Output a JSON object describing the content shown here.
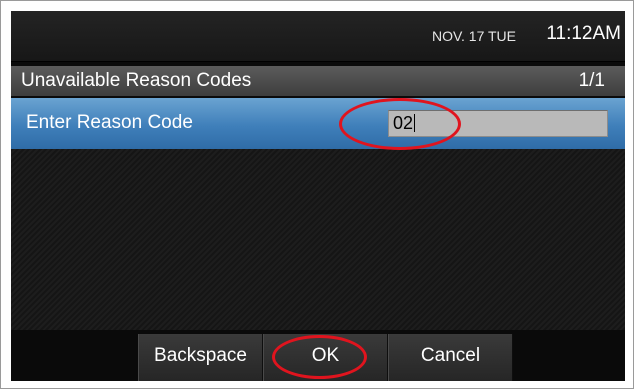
{
  "status": {
    "date": "NOV. 17 TUE",
    "time": "11:12AM"
  },
  "header": {
    "title": "Unavailable Reason Codes",
    "page": "1/1"
  },
  "entry": {
    "label": "Enter Reason Code",
    "value": "02"
  },
  "softkeys": {
    "backspace": "Backspace",
    "ok": "OK",
    "cancel": "Cancel"
  },
  "colors": {
    "highlight_row": "#3f7fba",
    "annotation": "#e0141e",
    "input_bg": "#b9b9b9"
  }
}
